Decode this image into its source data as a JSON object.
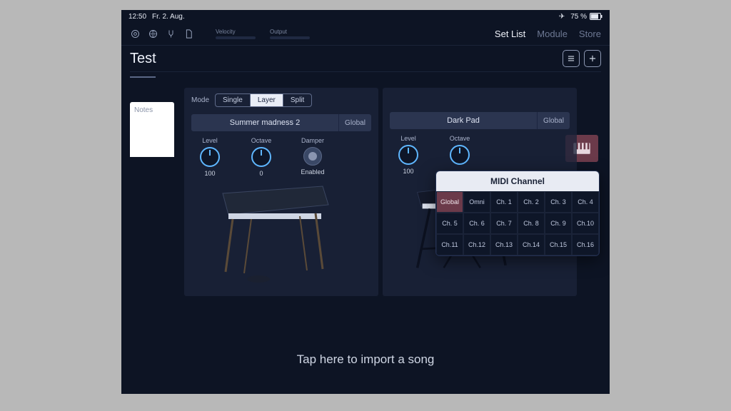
{
  "status": {
    "time": "12:50",
    "date": "Fr. 2. Aug.",
    "battery": "75 %"
  },
  "toolbar": {
    "meters": [
      {
        "label": "Velocity"
      },
      {
        "label": "Output"
      }
    ],
    "tabs": {
      "setlist": "Set List",
      "module": "Module",
      "store": "Store"
    }
  },
  "title": "Test",
  "sidebar": {
    "notes": "Notes"
  },
  "mode": {
    "label": "Mode",
    "options": {
      "single": "Single",
      "layer": "Layer",
      "split": "Split"
    },
    "selected": "Layer"
  },
  "layers": [
    {
      "preset_name": "Summer madness 2",
      "global_label": "Global",
      "knobs": {
        "level": {
          "label": "Level",
          "value": "100"
        },
        "octave": {
          "label": "Octave",
          "value": "0"
        },
        "damper": {
          "label": "Damper",
          "value": "Enabled"
        }
      }
    },
    {
      "preset_name": "Dark Pad",
      "global_label": "Global",
      "knobs": {
        "level": {
          "label": "Level",
          "value": "100"
        },
        "octave": {
          "label": "Octave",
          "value": ""
        }
      }
    }
  ],
  "popover": {
    "title": "MIDI Channel",
    "selected": "Global",
    "cells": [
      "Global",
      "Omni",
      "Ch. 1",
      "Ch. 2",
      "Ch. 3",
      "Ch. 4",
      "Ch. 5",
      "Ch. 6",
      "Ch. 7",
      "Ch. 8",
      "Ch. 9",
      "Ch.10",
      "Ch.11",
      "Ch.12",
      "Ch.13",
      "Ch.14",
      "Ch.15",
      "Ch.16"
    ]
  },
  "footer": "Tap here to import a song"
}
